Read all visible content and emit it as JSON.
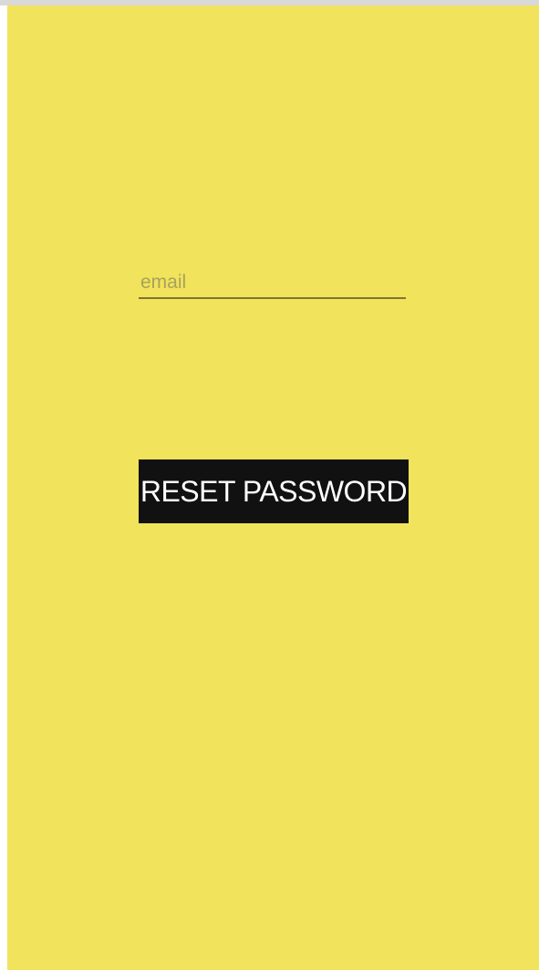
{
  "colors": {
    "background": "#f1e35c",
    "button_background": "#111111",
    "button_text": "#ffffff",
    "field_underline": "#7e762f",
    "placeholder": "#a9a25a"
  },
  "form": {
    "email": {
      "value": "",
      "placeholder": "email"
    },
    "reset_button_label": "RESET PASSWORD"
  }
}
